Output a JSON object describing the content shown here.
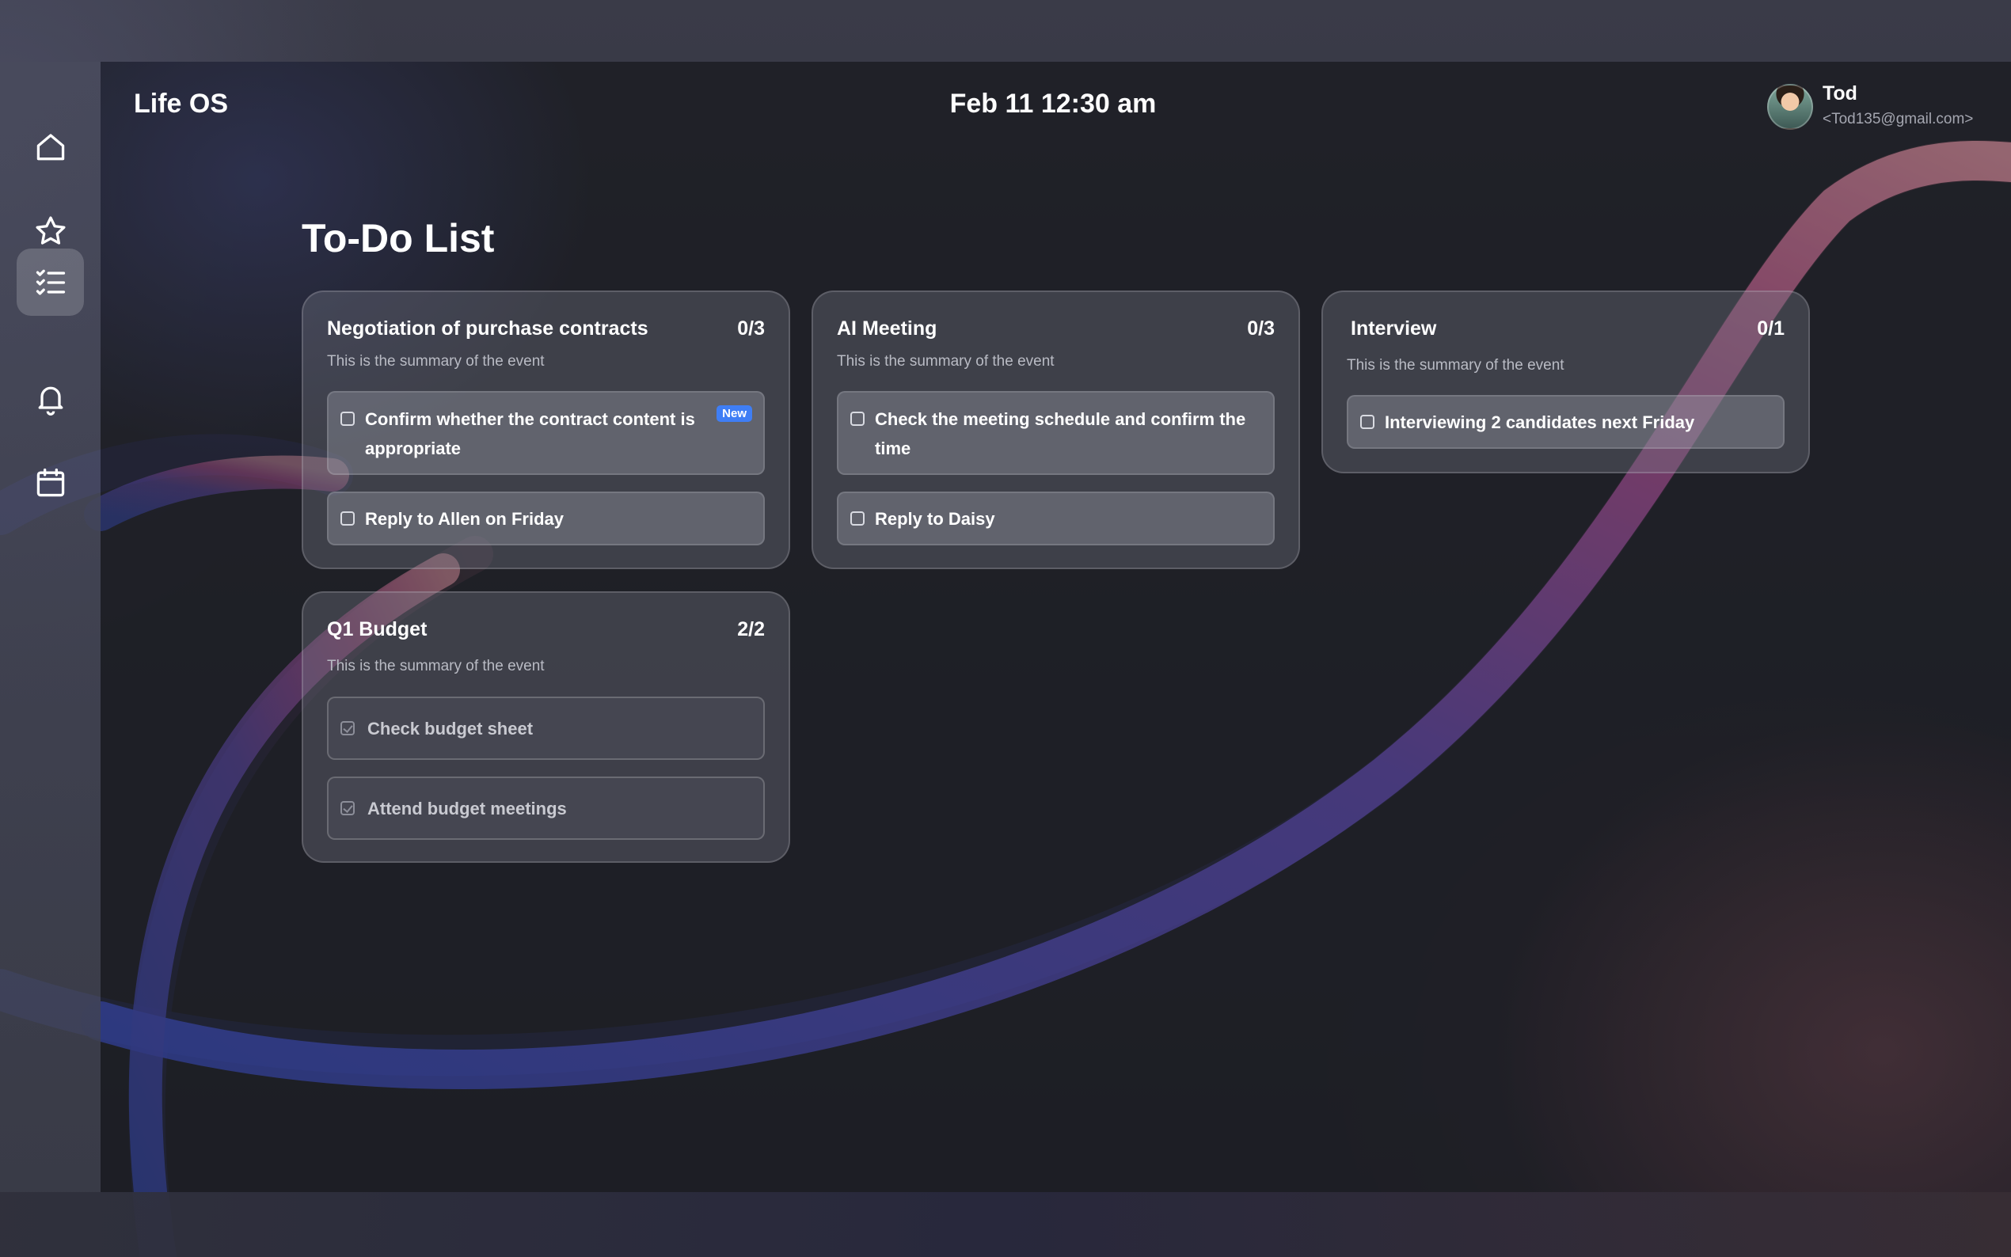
{
  "app": {
    "title": "Life OS",
    "datetime": "Feb 11 12:30 am"
  },
  "user": {
    "name": "Tod",
    "email": "<Tod135@gmail.com>"
  },
  "sidebar": {
    "items": [
      {
        "id": "home",
        "icon": "home-icon",
        "active": false
      },
      {
        "id": "favorites",
        "icon": "star-icon",
        "active": false
      },
      {
        "id": "todo",
        "icon": "checklist-icon",
        "active": true
      },
      {
        "id": "notifications",
        "icon": "bell-icon",
        "active": false
      },
      {
        "id": "calendar",
        "icon": "calendar-icon",
        "active": false
      }
    ]
  },
  "page": {
    "title": "To-Do List"
  },
  "cards": [
    {
      "title": "Negotiation of purchase contracts",
      "count": "0/3",
      "summary": "This is the summary of the event",
      "tasks": [
        {
          "text": "Confirm whether the contract content is appropriate",
          "badge": "New",
          "done": false
        },
        {
          "text": "Reply to Allen on Friday",
          "done": false
        }
      ]
    },
    {
      "title": "AI Meeting",
      "count": "0/3",
      "summary": "This is the summary of the event",
      "tasks": [
        {
          "text": "Check the meeting schedule and confirm the time",
          "done": false
        },
        {
          "text": "Reply to Daisy",
          "done": false
        }
      ]
    },
    {
      "title": "Interview",
      "count": "0/1",
      "summary": "This is the summary of the event",
      "tasks": [
        {
          "text": "Interviewing 2 candidates next Friday",
          "done": false
        }
      ]
    },
    {
      "title": "Q1 Budget",
      "count": "2/2",
      "summary": "This is the summary of the event",
      "tasks": [
        {
          "text": "Check budget sheet",
          "done": true
        },
        {
          "text": "Attend budget meetings",
          "done": true
        }
      ]
    }
  ],
  "colors": {
    "accent_badge": "#3f7ef5",
    "swoosh_start": "#3d4aa8",
    "swoosh_end": "#c06a8a"
  }
}
